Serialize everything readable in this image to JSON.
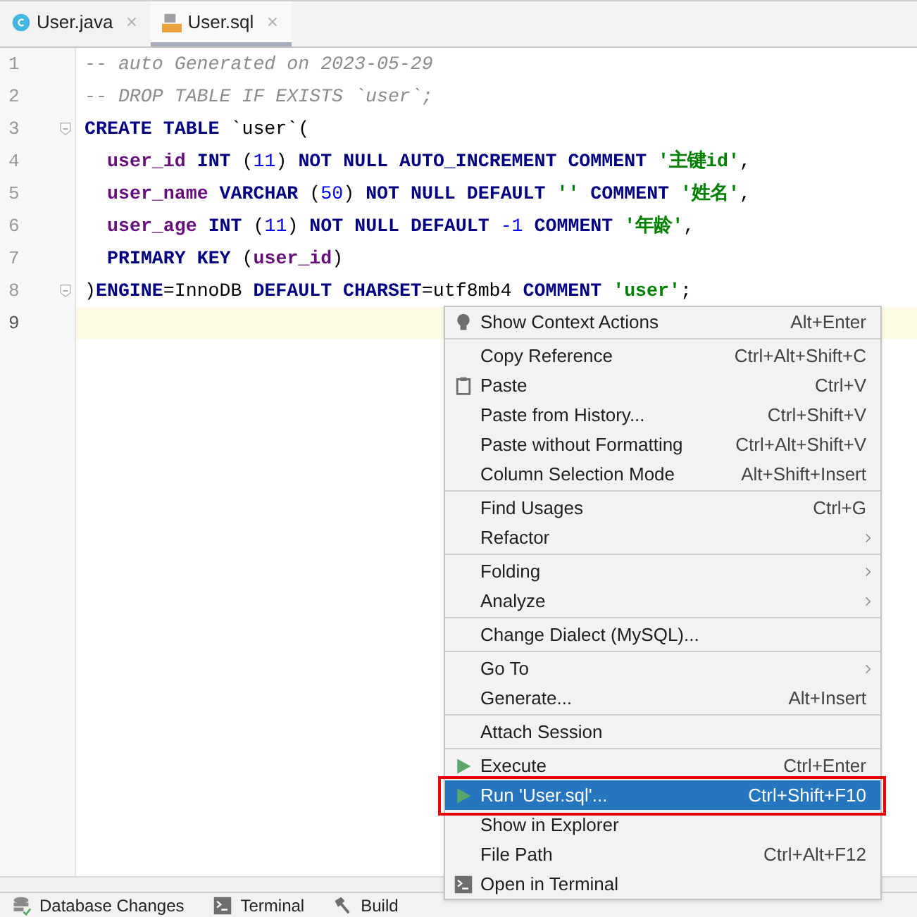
{
  "tabs": [
    {
      "label": "User.java",
      "kind": "class",
      "selected": false
    },
    {
      "label": "User.sql",
      "kind": "sql",
      "selected": true
    }
  ],
  "editor": {
    "lines": [
      {
        "number": "1",
        "fold": false,
        "current": false,
        "indented": false,
        "tokens": [
          {
            "kind": "comment",
            "text": "-- auto Generated on 2023-05-29"
          }
        ]
      },
      {
        "number": "2",
        "fold": false,
        "current": false,
        "indented": false,
        "tokens": [
          {
            "kind": "comment",
            "text": "-- DROP TABLE IF EXISTS `user`;"
          }
        ]
      },
      {
        "number": "3",
        "fold": true,
        "current": false,
        "indented": false,
        "tokens": [
          {
            "kind": "keyword",
            "text": "CREATE TABLE "
          },
          {
            "kind": "plain",
            "text": "`user`("
          }
        ]
      },
      {
        "number": "4",
        "fold": false,
        "current": false,
        "indented": true,
        "tokens": [
          {
            "kind": "ident",
            "text": "user_id"
          },
          {
            "kind": "keyword",
            "text": " INT "
          },
          {
            "kind": "plain",
            "text": "("
          },
          {
            "kind": "number",
            "text": "11"
          },
          {
            "kind": "plain",
            "text": ") "
          },
          {
            "kind": "keyword",
            "text": "NOT NULL AUTO_INCREMENT COMMENT "
          },
          {
            "kind": "string",
            "text": "'主键id'"
          },
          {
            "kind": "plain",
            "text": ","
          }
        ]
      },
      {
        "number": "5",
        "fold": false,
        "current": false,
        "indented": true,
        "tokens": [
          {
            "kind": "ident",
            "text": "user_name"
          },
          {
            "kind": "keyword",
            "text": " VARCHAR "
          },
          {
            "kind": "plain",
            "text": "("
          },
          {
            "kind": "number",
            "text": "50"
          },
          {
            "kind": "plain",
            "text": ") "
          },
          {
            "kind": "keyword",
            "text": "NOT NULL DEFAULT "
          },
          {
            "kind": "string",
            "text": "''"
          },
          {
            "kind": "keyword",
            "text": " COMMENT "
          },
          {
            "kind": "string",
            "text": "'姓名'"
          },
          {
            "kind": "plain",
            "text": ","
          }
        ]
      },
      {
        "number": "6",
        "fold": false,
        "current": false,
        "indented": true,
        "tokens": [
          {
            "kind": "ident",
            "text": "user_age"
          },
          {
            "kind": "keyword",
            "text": " INT "
          },
          {
            "kind": "plain",
            "text": "("
          },
          {
            "kind": "number",
            "text": "11"
          },
          {
            "kind": "plain",
            "text": ") "
          },
          {
            "kind": "keyword",
            "text": "NOT NULL DEFAULT "
          },
          {
            "kind": "number",
            "text": "-1"
          },
          {
            "kind": "keyword",
            "text": " COMMENT "
          },
          {
            "kind": "string",
            "text": "'年龄'"
          },
          {
            "kind": "plain",
            "text": ","
          }
        ]
      },
      {
        "number": "7",
        "fold": false,
        "current": false,
        "indented": true,
        "tokens": [
          {
            "kind": "keyword",
            "text": "PRIMARY KEY "
          },
          {
            "kind": "plain",
            "text": "("
          },
          {
            "kind": "ident",
            "text": "user_id"
          },
          {
            "kind": "plain",
            "text": ")"
          }
        ]
      },
      {
        "number": "8",
        "fold": true,
        "current": false,
        "indented": false,
        "tokens": [
          {
            "kind": "plain",
            "text": ")"
          },
          {
            "kind": "keyword",
            "text": "ENGINE"
          },
          {
            "kind": "plain",
            "text": "=InnoDB "
          },
          {
            "kind": "keyword",
            "text": "DEFAULT CHARSET"
          },
          {
            "kind": "plain",
            "text": "=utf8mb4 "
          },
          {
            "kind": "keyword",
            "text": "COMMENT "
          },
          {
            "kind": "string",
            "text": "'user'"
          },
          {
            "kind": "plain",
            "text": ";"
          }
        ]
      },
      {
        "number": "9",
        "fold": false,
        "current": true
      }
    ]
  },
  "context_menu": {
    "groups": [
      [
        {
          "label": "Show Context Actions",
          "shortcut": "Alt+Enter",
          "kind": "bulb",
          "submenu": false,
          "selected": false,
          "framed": false
        }
      ],
      [
        {
          "label": "Copy Reference",
          "shortcut": "Ctrl+Alt+Shift+C",
          "submenu": false,
          "selected": false,
          "framed": false
        },
        {
          "label": "Paste",
          "shortcut": "Ctrl+V",
          "kind": "clipboard",
          "submenu": false,
          "selected": false,
          "framed": false
        },
        {
          "label": "Paste from History...",
          "shortcut": "Ctrl+Shift+V",
          "submenu": false,
          "selected": false,
          "framed": false
        },
        {
          "label": "Paste without Formatting",
          "shortcut": "Ctrl+Alt+Shift+V",
          "submenu": false,
          "selected": false,
          "framed": false
        },
        {
          "label": "Column Selection Mode",
          "shortcut": "Alt+Shift+Insert",
          "submenu": false,
          "selected": false,
          "framed": false
        }
      ],
      [
        {
          "label": "Find Usages",
          "shortcut": "Ctrl+G",
          "submenu": false,
          "selected": false,
          "framed": false
        },
        {
          "label": "Refactor",
          "submenu": true,
          "selected": false,
          "framed": false
        }
      ],
      [
        {
          "label": "Folding",
          "submenu": true,
          "selected": false,
          "framed": false
        },
        {
          "label": "Analyze",
          "submenu": true,
          "selected": false,
          "framed": false
        }
      ],
      [
        {
          "label": "Change Dialect (MySQL)...",
          "submenu": false,
          "selected": false,
          "framed": false
        }
      ],
      [
        {
          "label": "Go To",
          "submenu": true,
          "selected": false,
          "framed": false
        },
        {
          "label": "Generate...",
          "shortcut": "Alt+Insert",
          "submenu": false,
          "selected": false,
          "framed": false
        }
      ],
      [
        {
          "label": "Attach Session",
          "submenu": false,
          "selected": false,
          "framed": false
        }
      ],
      [
        {
          "label": "Execute",
          "shortcut": "Ctrl+Enter",
          "kind": "play",
          "submenu": false,
          "selected": false,
          "framed": false
        },
        {
          "label": "Run 'User.sql'...",
          "shortcut": "Ctrl+Shift+F10",
          "kind": "play",
          "submenu": false,
          "selected": true,
          "framed": true
        },
        {
          "label": "Show in Explorer",
          "submenu": false,
          "selected": false,
          "framed": false
        },
        {
          "label": "File Path",
          "shortcut": "Ctrl+Alt+F12",
          "submenu": false,
          "selected": false,
          "framed": false
        },
        {
          "label": "Open in Terminal",
          "kind": "terminal",
          "submenu": false,
          "selected": false,
          "framed": false
        }
      ]
    ]
  },
  "tool_windows": [
    {
      "label": "Database Changes",
      "kind": "database"
    },
    {
      "label": "Terminal",
      "kind": "terminal"
    },
    {
      "label": "Build",
      "kind": "hammer"
    }
  ]
}
